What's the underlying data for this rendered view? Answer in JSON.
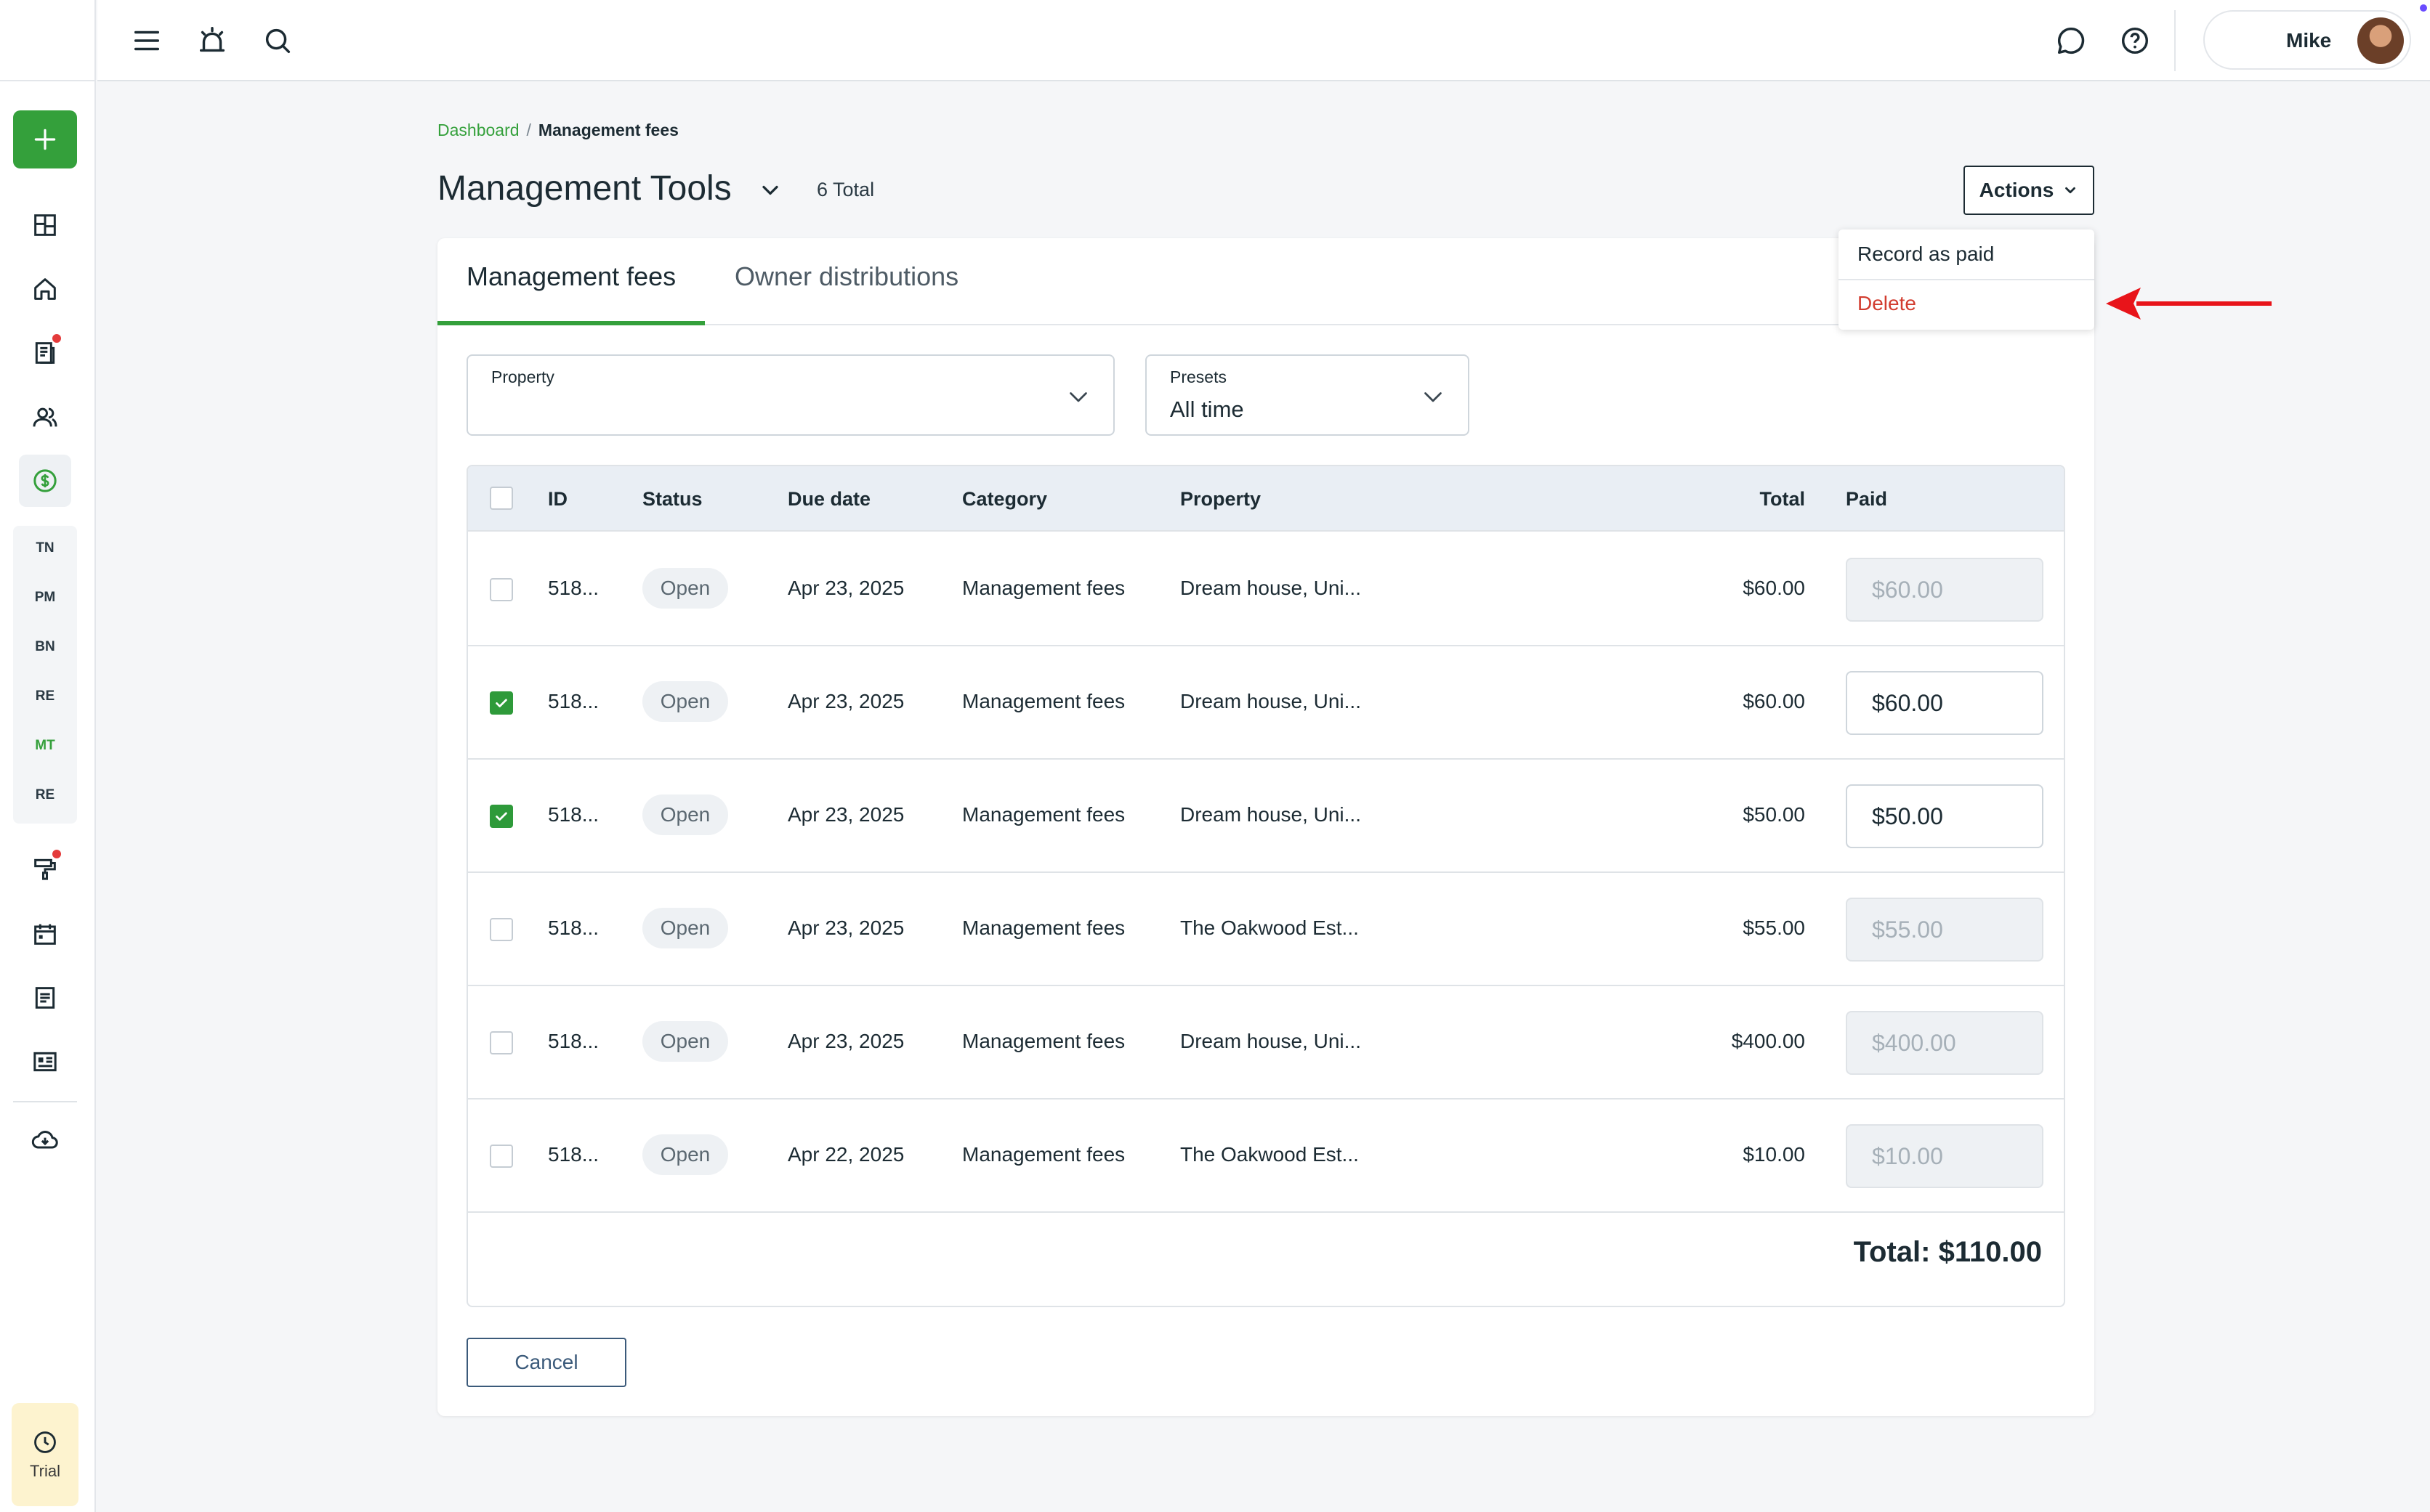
{
  "topbar": {
    "user_name": "Mike"
  },
  "sidebar": {
    "codes": [
      "TN",
      "PM",
      "BN",
      "RE",
      "MT",
      "RE"
    ],
    "active_code": "MT",
    "trial_label": "Trial"
  },
  "breadcrumb": {
    "root": "Dashboard",
    "separator": "/",
    "current": "Management fees"
  },
  "header": {
    "title": "Management Tools",
    "total_count": "6 Total",
    "actions_label": "Actions"
  },
  "actions_menu": {
    "items": [
      "Record as paid",
      "Delete"
    ]
  },
  "tabs": [
    {
      "label": "Management fees",
      "active": true
    },
    {
      "label": "Owner distributions",
      "active": false
    }
  ],
  "filters": {
    "property": {
      "label": "Property",
      "value": ""
    },
    "presets": {
      "label": "Presets",
      "value": "All time"
    }
  },
  "table": {
    "columns": [
      "ID",
      "Status",
      "Due date",
      "Category",
      "Property",
      "Total",
      "Paid"
    ],
    "rows": [
      {
        "checked": false,
        "id": "518...",
        "status": "Open",
        "due": "Apr 23, 2025",
        "category": "Management fees",
        "property": "Dream house, Uni...",
        "total": "$60.00",
        "paid": "$60.00"
      },
      {
        "checked": true,
        "id": "518...",
        "status": "Open",
        "due": "Apr 23, 2025",
        "category": "Management fees",
        "property": "Dream house, Uni...",
        "total": "$60.00",
        "paid": "$60.00"
      },
      {
        "checked": true,
        "id": "518...",
        "status": "Open",
        "due": "Apr 23, 2025",
        "category": "Management fees",
        "property": "Dream house, Uni...",
        "total": "$50.00",
        "paid": "$50.00"
      },
      {
        "checked": false,
        "id": "518...",
        "status": "Open",
        "due": "Apr 23, 2025",
        "category": "Management fees",
        "property": "The Oakwood Est...",
        "total": "$55.00",
        "paid": "$55.00"
      },
      {
        "checked": false,
        "id": "518...",
        "status": "Open",
        "due": "Apr 23, 2025",
        "category": "Management fees",
        "property": "Dream house, Uni...",
        "total": "$400.00",
        "paid": "$400.00"
      },
      {
        "checked": false,
        "id": "518...",
        "status": "Open",
        "due": "Apr 22, 2025",
        "category": "Management fees",
        "property": "The Oakwood Est...",
        "total": "$10.00",
        "paid": "$10.00"
      }
    ],
    "grand_total": "Total: $110.00"
  },
  "footer": {
    "cancel_label": "Cancel"
  },
  "colors": {
    "accent_green": "#34a03b",
    "delete_red": "#d23c2f",
    "annotation_arrow": "#e8141a"
  },
  "icons": {
    "topbar": [
      "menu-icon",
      "alarm-icon",
      "search-icon",
      "chat-icon",
      "help-icon"
    ],
    "sidebar": [
      "plus-icon",
      "dashboard-icon",
      "home-icon",
      "documents-icon",
      "people-icon",
      "dollar-icon",
      "maintenance-icon",
      "calendar-icon",
      "notes-icon",
      "reports-icon",
      "cloud-download-icon",
      "clock-icon"
    ]
  }
}
